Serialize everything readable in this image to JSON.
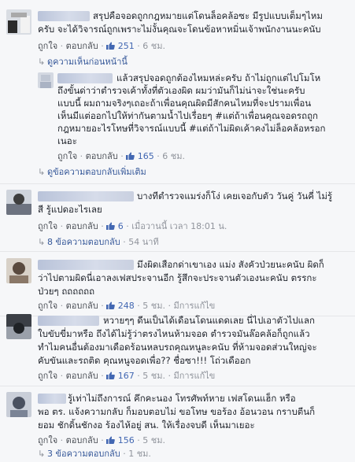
{
  "comments": [
    {
      "lines": [
        "สรุปคือจอดถูกกฎหมายแต่โดนล็อคล้อซะ มีรูปแบบเต็มๆไหม",
        "ครับ จะได้วิจารณ์ถูกเพราะไม่งั้นคุณจะโดนข้อหาหมิ่นเจ้าพนักงานนะคนับ"
      ],
      "like": "ถูกใจ",
      "reply": "ตอบกลับ",
      "count": "251",
      "time": "6 ชม."
    },
    {
      "lines": [
        "แล้วสรุปจอดถูกต้องไหมหล่ะครับ ถ้าไม่ถูกแต่ไปโมโห",
        "ถึงขั้นด่าว่าตำรวจเค้าทั้งที่ตัวเองผิด ผมว่ามันก็ไม่น่าจะใช่นะครับ",
        "แบบนี้ ผมถามจริงๆเถอะถ้าเพื่อนคุณผิดมีสักคนไหมที่จะปรามเพื่อน",
        "เห็นมีแต่ออกไปให้ท่ากันตามน้ำไปเรื่อยๆ #แต่ถ้าเพื่อนคุณจอดรถถูก",
        "กฎหมายอะไรโทษที่วิจารณ์แบบนี้ #แต่ถ้าไม่ผิดเค้าคงไม่ล็อคล้อหรอก",
        "เนอะ"
      ],
      "like": "ถูกใจ",
      "reply": "ตอบกลับ",
      "count": "165",
      "time": "6 ชม."
    },
    {
      "lines": [
        "บางทีตำรวจแมร่งก็โง่ เคยเจอกับตัว วันคู่ วันคี่ ไม่รู้",
        "สี รู้แปดอะไรเลย"
      ],
      "like": "ถูกใจ",
      "reply": "ตอบกลับ",
      "count": "6",
      "time": "เมื่อวานนี้ เวลา 18:01 น."
    },
    {
      "lines": [
        "มึงผิดเสือกด่าเขาเอง แม่ง สังคัวป่วยนะคนับ ผิดก็",
        "ว่าไปตามผิดนี่เอาลงเฟสประจานอีก รู้สึกจะประจานตัวเองนะคนับ ตรรกะ",
        "ป่วยๆ ถถถถถถ"
      ],
      "like": "ถูกใจ",
      "reply": "ตอบกลับ",
      "count": "248",
      "time": "5 ชม.",
      "edited": "มีการแก้ไข"
    },
    {
      "lines": [
        "หวายๆๆ ดีนเป็นได้เดือนโดนแดดเลย นี่ไปเอาตัวไปแลก",
        "ใบขับขี่มาหรือ ถึงได้ไม่รู้ว่าตรงไหนห้ามจอด ตำรวจมันล๊อคล้อก็ถูกแล้ว",
        "ทำไมคนอื่นต้องมาเดือดร้อนหลบรถคุณหนูละคนับ ที่ห้ามจอดส่วนใหญ่จะ",
        "คับขันและรถติด คุณหนูจอดเพื่อ?? ชื่อซา!!! โถ่วเดืออก"
      ],
      "like": "ถูกใจ",
      "reply": "ตอบกลับ",
      "count": "167",
      "time": "5 ชม.",
      "edited": "มีการแก้ไข"
    },
    {
      "lines": [
        "รู้เท่าไม่ถึงการณ์ คึกคะนอง โทรศัพท์หาย เฟสโดนแฮ็ก หรือ",
        "พอ ตร. แจ้งความกลับ ก็มอบตอบไม่ ขอโทษ ขอร้อง อ้อนวอน กราบตีนก็",
        "ยอม ชักดิ้นชักงอ ร้องไห้อยู่ สน. ให้เรื่องจบดี เห็นมาเยอะ"
      ],
      "like": "ถูกใจ",
      "reply": "ตอบกลับ",
      "count": "156",
      "time": "5 ชม."
    }
  ],
  "reply_links": {
    "prev": "ดูความเห็นก่อนหน้านี้",
    "more": "ดูข้อความตอบกลับเพิ่มเติม",
    "replies8": "8 ข้อความตอบกลับ",
    "replies8_time": "54 นาที",
    "replies3": "3 ข้อความตอบกลับ",
    "replies3_time": "1 ชม."
  },
  "colors": {
    "link": "#365899",
    "meta": "#90949c",
    "like_blue": "#4267b2",
    "bg": "#f6f7f9"
  }
}
